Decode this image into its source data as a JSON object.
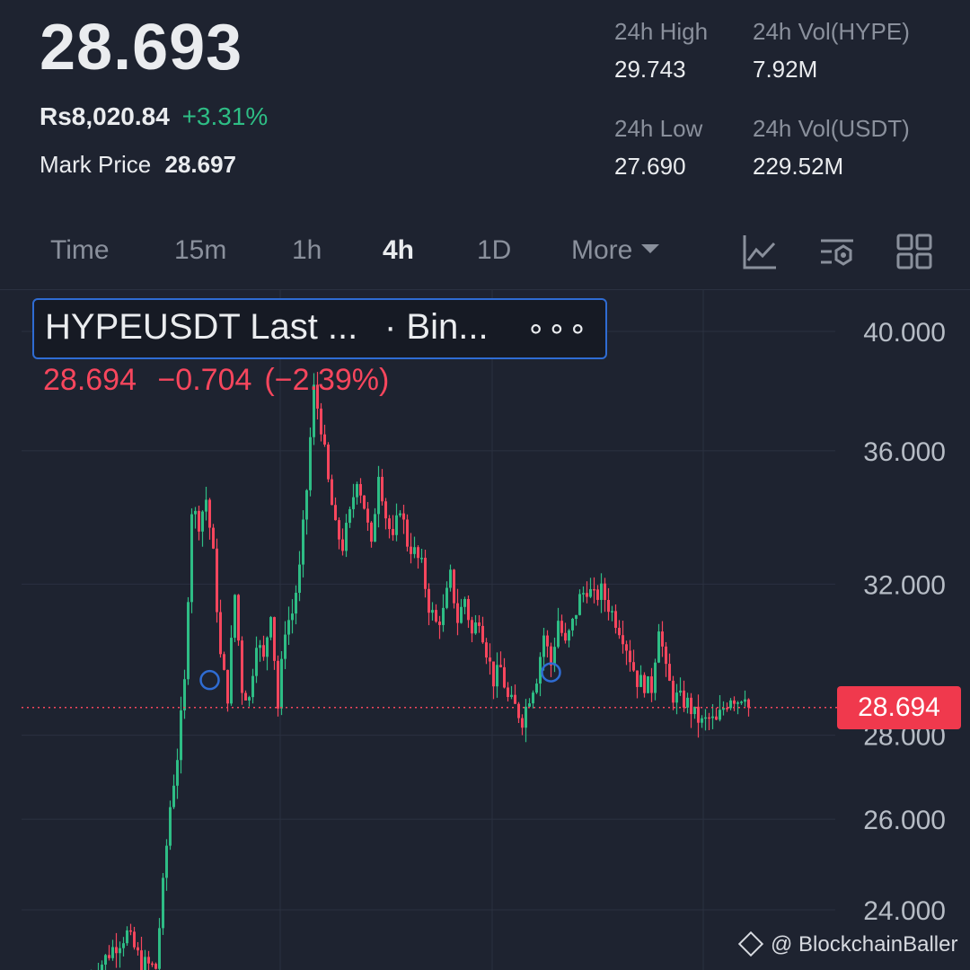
{
  "header": {
    "last_price": "28.693",
    "fiat_price": "Rs8,020.84",
    "change_pct": "+3.31%",
    "mark_price_label": "Mark Price",
    "mark_price": "28.697"
  },
  "stats": {
    "high_label": "24h High",
    "high": "29.743",
    "vol_base_label": "24h Vol(HYPE)",
    "vol_base": "7.92M",
    "low_label": "24h Low",
    "low": "27.690",
    "vol_quote_label": "24h Vol(USDT)",
    "vol_quote": "229.52M"
  },
  "tabs": {
    "time": "Time",
    "m15": "15m",
    "h1": "1h",
    "h4": "4h",
    "d1": "1D",
    "more": "More",
    "active": "4h"
  },
  "icons": [
    "indicators-icon",
    "chart-settings-icon",
    "layout-grid-icon"
  ],
  "legend": {
    "symbol": "HYPEUSDT Last ...",
    "exchange": "· Bin...",
    "more": "∘∘∘",
    "price": "28.694",
    "change": "−0.704",
    "change_pct": "(−2.39%)"
  },
  "price_tag": "28.694",
  "watermark": "@ BlockchainBaller",
  "colors": {
    "up": "#2ebd85",
    "down": "#f6465d",
    "accent": "#2f6cd3",
    "background": "#1e2330"
  },
  "chart_data": {
    "type": "candlestick",
    "interval": "4h",
    "current_price": 28.694,
    "y_tick_labels": [
      "40.000",
      "36.000",
      "32.000",
      "28.000",
      "26.000",
      "24.000"
    ],
    "y_ticks": [
      40,
      36,
      32,
      28,
      26,
      24
    ],
    "grid": true,
    "scale": "log",
    "visible_range": [
      22.7,
      40.6
    ],
    "markers": [
      {
        "index": 33,
        "price": 29.4
      },
      {
        "index": 128,
        "price": 29.6
      }
    ],
    "close_path": [
      [
        0,
        22.6
      ],
      [
        6,
        23.2
      ],
      [
        10,
        23.5
      ],
      [
        14,
        22.9
      ],
      [
        18,
        22.8
      ],
      [
        20,
        24.5
      ],
      [
        22,
        26.3
      ],
      [
        24,
        27.5
      ],
      [
        26,
        29.3
      ],
      [
        28,
        34.2
      ],
      [
        30,
        33.8
      ],
      [
        32,
        34.5
      ],
      [
        34,
        32.8
      ],
      [
        36,
        30.0
      ],
      [
        38,
        29.0
      ],
      [
        40,
        31.7
      ],
      [
        42,
        29.2
      ],
      [
        44,
        28.9
      ],
      [
        46,
        30.5
      ],
      [
        48,
        29.9
      ],
      [
        50,
        31.3
      ],
      [
        52,
        28.7
      ],
      [
        54,
        30.8
      ],
      [
        56,
        31.2
      ],
      [
        58,
        32.4
      ],
      [
        60,
        34.8
      ],
      [
        62,
        38.0
      ],
      [
        64,
        36.8
      ],
      [
        66,
        35.0
      ],
      [
        68,
        33.6
      ],
      [
        70,
        33.1
      ],
      [
        72,
        34.0
      ],
      [
        74,
        35.2
      ],
      [
        76,
        34.3
      ],
      [
        78,
        33.0
      ],
      [
        80,
        35.4
      ],
      [
        82,
        34.0
      ],
      [
        84,
        33.2
      ],
      [
        86,
        34.3
      ],
      [
        88,
        33.2
      ],
      [
        90,
        32.9
      ],
      [
        92,
        32.5
      ],
      [
        94,
        31.4
      ],
      [
        96,
        30.9
      ],
      [
        98,
        31.2
      ],
      [
        100,
        32.2
      ],
      [
        102,
        31.0
      ],
      [
        104,
        31.6
      ],
      [
        106,
        30.6
      ],
      [
        108,
        31.1
      ],
      [
        110,
        30.2
      ],
      [
        112,
        29.4
      ],
      [
        114,
        29.7
      ],
      [
        116,
        28.9
      ],
      [
        118,
        28.7
      ],
      [
        120,
        28.4
      ],
      [
        122,
        29.0
      ],
      [
        124,
        29.5
      ],
      [
        126,
        30.6
      ],
      [
        128,
        29.8
      ],
      [
        130,
        31.0
      ],
      [
        132,
        30.3
      ],
      [
        134,
        30.9
      ],
      [
        136,
        31.6
      ],
      [
        138,
        31.9
      ],
      [
        140,
        31.6
      ],
      [
        142,
        31.8
      ],
      [
        144,
        31.4
      ],
      [
        146,
        31.0
      ],
      [
        148,
        30.6
      ],
      [
        150,
        30.0
      ],
      [
        152,
        29.4
      ],
      [
        154,
        29.3
      ],
      [
        156,
        29.2
      ],
      [
        158,
        30.9
      ],
      [
        160,
        29.6
      ],
      [
        162,
        29.0
      ],
      [
        164,
        28.9
      ],
      [
        166,
        28.8
      ],
      [
        168,
        28.5
      ],
      [
        170,
        28.3
      ],
      [
        172,
        28.4
      ],
      [
        174,
        28.3
      ],
      [
        176,
        28.7
      ],
      [
        178,
        29.0
      ],
      [
        180,
        28.9
      ],
      [
        182,
        29.1
      ],
      [
        183,
        28.69
      ]
    ]
  }
}
